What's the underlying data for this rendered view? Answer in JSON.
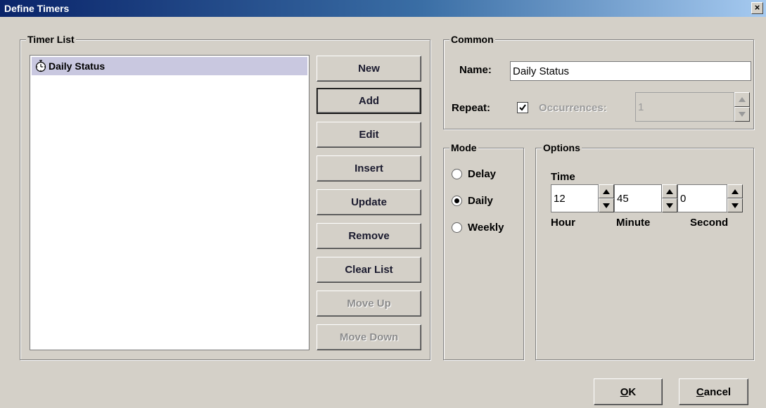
{
  "window": {
    "title": "Define Timers",
    "close_glyph": "×"
  },
  "timer_list": {
    "group_title": "Timer List",
    "items": [
      {
        "label": "Daily Status",
        "icon": "stopwatch-icon",
        "selected": true
      }
    ]
  },
  "buttons": [
    {
      "label": "New",
      "enabled": true
    },
    {
      "label": "Add",
      "enabled": true,
      "focused": true
    },
    {
      "label": "Edit",
      "enabled": true
    },
    {
      "label": "Insert",
      "enabled": true
    },
    {
      "label": "Update",
      "enabled": true
    },
    {
      "label": "Remove",
      "enabled": true
    },
    {
      "label": "Clear List",
      "enabled": true
    },
    {
      "label": "Move Up",
      "enabled": false
    },
    {
      "label": "Move Down",
      "enabled": false
    }
  ],
  "common": {
    "group_title": "Common",
    "name_label": "Name:",
    "name_value": "Daily Status",
    "repeat_label": "Repeat:",
    "repeat_checked": true,
    "occurrences_label": "Occurrences:",
    "occurrences_value": "1"
  },
  "mode": {
    "group_title": "Mode",
    "options": [
      {
        "label": "Delay",
        "checked": false
      },
      {
        "label": "Daily",
        "checked": true
      },
      {
        "label": "Weekly",
        "checked": false
      }
    ]
  },
  "options": {
    "group_title": "Options",
    "time_label": "Time",
    "hour_value": "12",
    "minute_value": "45",
    "second_value": "0",
    "hour_label": "Hour",
    "minute_label": "Minute",
    "second_label": "Second"
  },
  "dialog_buttons": {
    "ok_mnemonic": "O",
    "ok_rest": "K",
    "cancel_mnemonic": "C",
    "cancel_rest": "ancel"
  },
  "colors": {
    "selection": "#c9c8e0",
    "title_bar": "#0a246a",
    "background": "#d4d0c8"
  }
}
